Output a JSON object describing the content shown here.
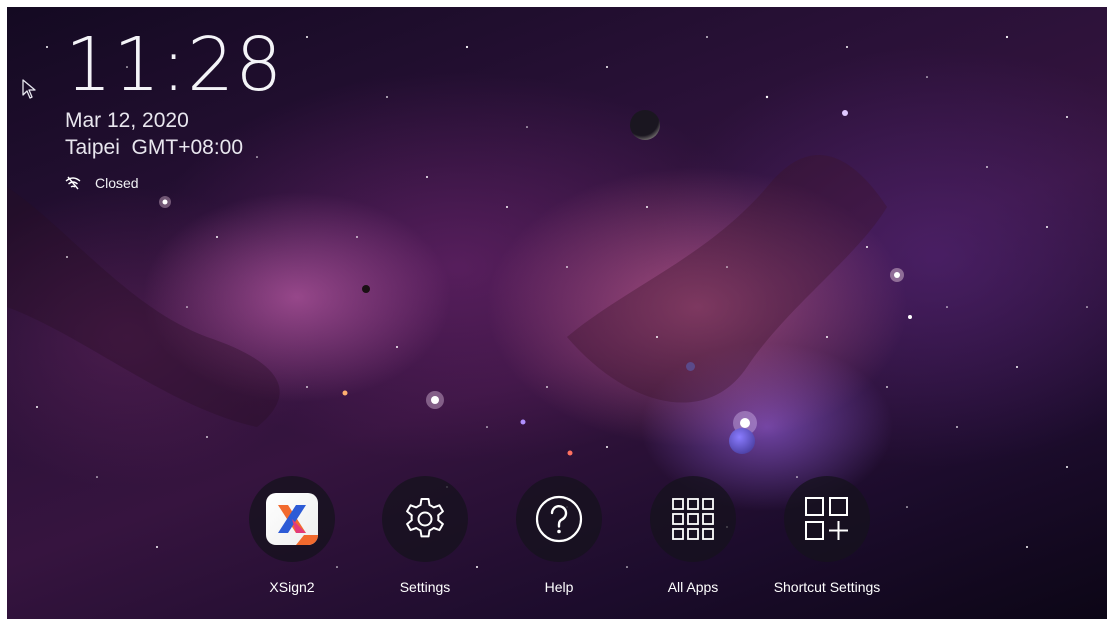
{
  "status": {
    "time": "11:28",
    "date": "Mar 12, 2020",
    "timezone": "Taipei  GMT+08:00",
    "network_icon": "wifi-off-icon",
    "network_label": "Closed"
  },
  "shortcuts": [
    {
      "label": "XSign2",
      "icon": "xsign2-app-icon"
    },
    {
      "label": "Settings",
      "icon": "gear-icon"
    },
    {
      "label": "Help",
      "icon": "question-mark-icon"
    },
    {
      "label": "All Apps",
      "icon": "app-grid-icon"
    },
    {
      "label": "Shortcut Settings",
      "icon": "add-shortcut-icon"
    }
  ],
  "colors": {
    "text": "#ffffff",
    "icon_disc": "#16121e",
    "xsign_orange": "#f26a2e",
    "xsign_blue": "#2d5bd6",
    "xsign_pink": "#e23a7a"
  }
}
